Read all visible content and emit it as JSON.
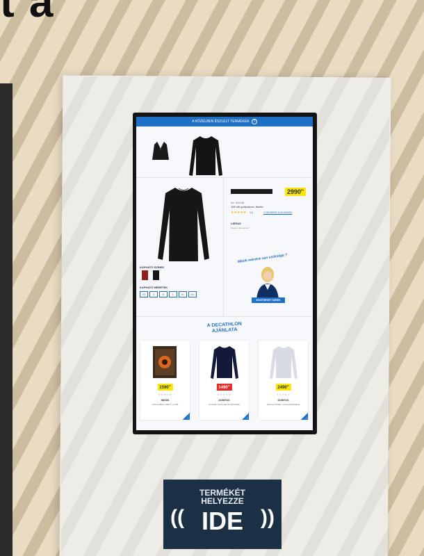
{
  "overlay_text": "t a",
  "screen": {
    "header": {
      "title": "A KÖZELBEN ÉSZLELT TERMÉKEK",
      "info_icon": "info-icon"
    },
    "product": {
      "price": "2990",
      "currency": "Ft",
      "ref": "Ref. 8343438",
      "name": "100 női golfpulóver, fekete",
      "rating_text": "4.6",
      "reviews_link": "2 VÉLEMÉNY ELOLVASÁSA",
      "desc_heading": "LEÍRÁS",
      "desc_text": "Hosszú ujjú pulóver",
      "colors_label": "KAPHATÓ SZÍNEK",
      "sizes_label": "KAPHATÓ MÉRETEK",
      "sizes": [
        "XS",
        "S",
        "M",
        "L",
        "XL",
        "2XL"
      ],
      "help_text": "Másik méretre van szüksége ?",
      "help_button": "SEGÍTSÉGET KÉREK"
    },
    "recommendations": {
      "title_line1": "A DECATHLON",
      "title_line2": "AJÁNLATA",
      "cards": [
        {
          "price": "1590",
          "currency": "Ft",
          "brand": "INESIS",
          "name": "GOLFLABDA SZETT, 12 DB",
          "price_style": "yellow"
        },
        {
          "price": "1490",
          "currency": "Ft",
          "brand": "DOMYOS",
          "name": "HOSSZÚ UJJÚ FELSŐ NŐKNEK",
          "price_style": "red"
        },
        {
          "price": "2490",
          "currency": "Ft",
          "brand": "DOMYOS",
          "name": "NŐI PULÓVER, VILÁGOSSZÜRKE",
          "price_style": "yellow"
        }
      ]
    }
  },
  "nfc_sign": {
    "line1": "TERMÉKÉT",
    "line2": "HELYEZZE",
    "big": "IDE"
  },
  "colors": {
    "accent": "#1f6fc5",
    "price_yellow": "#ffe600",
    "nfc_bg": "#1b2f45"
  }
}
